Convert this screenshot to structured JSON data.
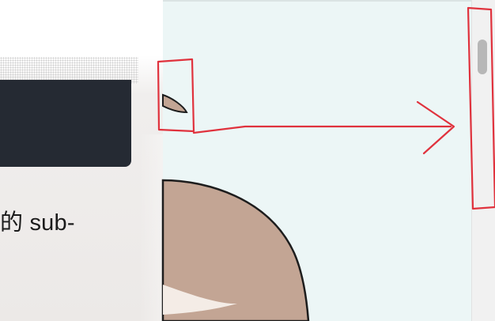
{
  "content": {
    "partial_text": "的 sub-"
  },
  "illustration": {
    "subject": "cartoon-character-head-partial",
    "colors": {
      "skin": "#c3a594",
      "outline": "#1d1d1d",
      "background": "#ecf6f6"
    }
  },
  "annotation": {
    "color": "#e0323d",
    "description_icon": "arrow-right-icon"
  },
  "ui": {
    "dark_card_color": "#252a33",
    "scrollbar_thumb_color": "#b7b7b7"
  }
}
